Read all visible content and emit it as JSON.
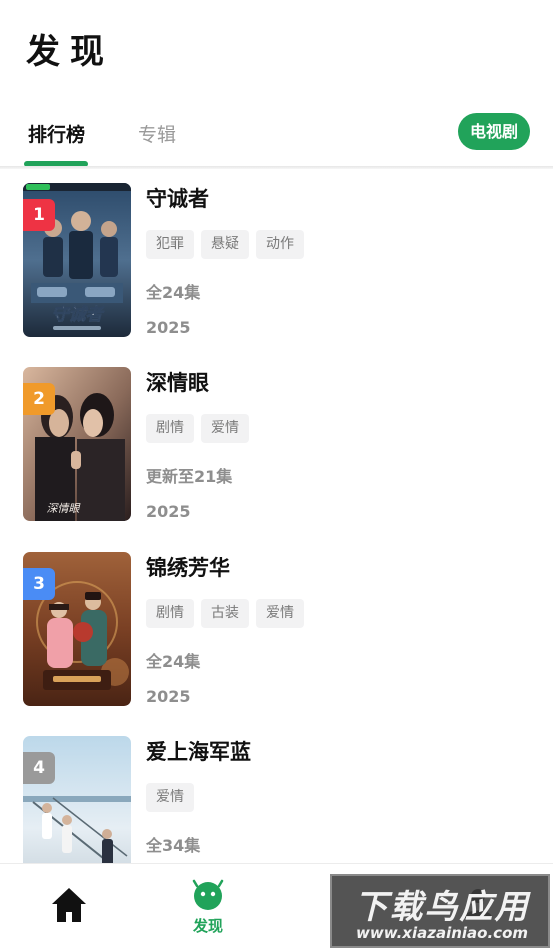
{
  "header": {
    "title": "发现",
    "tabs": [
      {
        "label": "排行榜",
        "active": true
      },
      {
        "label": "专辑",
        "active": false
      }
    ],
    "category": "电视剧"
  },
  "colors": {
    "accent": "#21a35a",
    "rank1": "#ee3344",
    "rank2": "#f09a2a",
    "rank3": "#4a8cf5",
    "rank4": "#9a9a9a"
  },
  "items": [
    {
      "rank": "1",
      "title": "守诚者",
      "tags": [
        "犯罪",
        "悬疑",
        "动作"
      ],
      "episodes": "全24集",
      "year": "2025",
      "poster_text": "守诚者"
    },
    {
      "rank": "2",
      "title": "深情眼",
      "tags": [
        "剧情",
        "爱情"
      ],
      "episodes": "更新至21集",
      "year": "2025",
      "poster_text": "深情眼"
    },
    {
      "rank": "3",
      "title": "锦绣芳华",
      "tags": [
        "剧情",
        "古装",
        "爱情"
      ],
      "episodes": "全24集",
      "year": "2025",
      "poster_text": ""
    },
    {
      "rank": "4",
      "title": "爱上海军蓝",
      "tags": [
        "爱情"
      ],
      "episodes": "全34集",
      "year": "",
      "poster_text": ""
    }
  ],
  "bottom_nav": {
    "items": [
      {
        "icon": "home-icon",
        "label": ""
      },
      {
        "icon": "discover-icon",
        "label": "发现"
      },
      {
        "icon": "profile-icon",
        "label": ""
      }
    ]
  },
  "watermark": {
    "main": "下载鸟应用",
    "url": "www.xiazainiao.com"
  }
}
